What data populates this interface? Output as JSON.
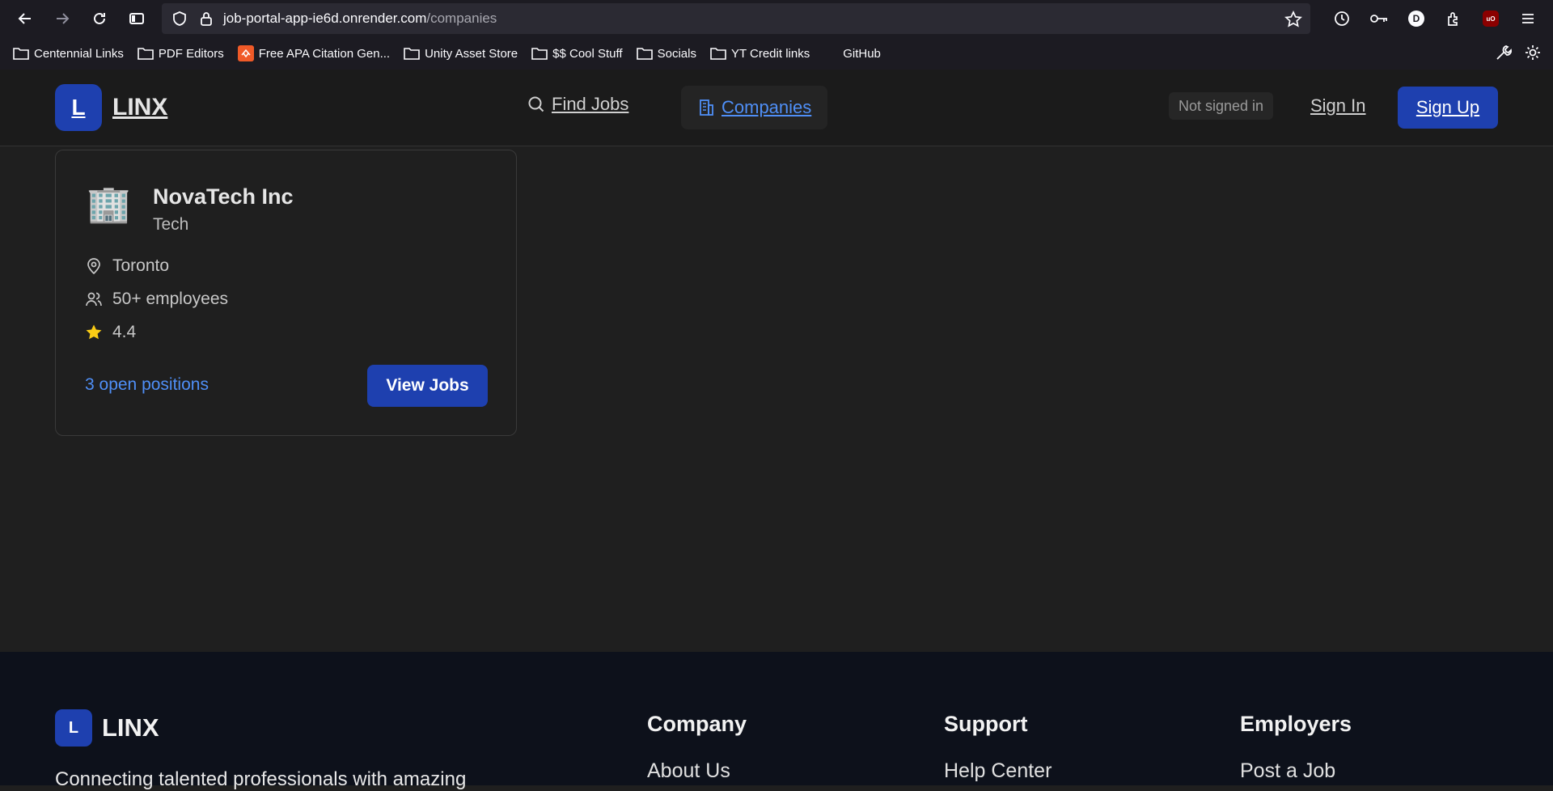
{
  "browser": {
    "url_host": "job-portal-app-ie6d.onrender.com",
    "url_path": "/companies",
    "profile_initial": "D",
    "ublock_label": "uO",
    "bookmarks": [
      {
        "label": "Centennial Links",
        "icon": "folder-icon"
      },
      {
        "label": "PDF Editors",
        "icon": "folder-icon"
      },
      {
        "label": "Free APA Citation Gen...",
        "icon": "apa-site-icon"
      },
      {
        "label": "Unity Asset Store",
        "icon": "folder-icon"
      },
      {
        "label": "$$ Cool Stuff",
        "icon": "folder-icon"
      },
      {
        "label": "Socials",
        "icon": "folder-icon"
      },
      {
        "label": "YT Credit links",
        "icon": "folder-icon"
      },
      {
        "label": "GitHub",
        "icon": "none"
      }
    ]
  },
  "header": {
    "logo_letter": "L",
    "logo_text": "LINX",
    "nav": {
      "find_jobs": "Find Jobs",
      "companies": "Companies"
    },
    "auth_status": "Not signed in",
    "sign_in": "Sign In",
    "sign_up": "Sign Up"
  },
  "company": {
    "logo_emoji": "🏢",
    "name": "NovaTech Inc",
    "industry": "Tech",
    "location": "Toronto",
    "employees": "50+ employees",
    "rating": "4.4",
    "open_positions": "3 open positions",
    "view_jobs": "View Jobs"
  },
  "footer": {
    "logo_letter": "L",
    "logo_text": "LINX",
    "tagline": "Connecting talented professionals with amazing",
    "columns": [
      {
        "title": "Company",
        "first_link": "About Us"
      },
      {
        "title": "Support",
        "first_link": "Help Center"
      },
      {
        "title": "Employers",
        "first_link": "Post a Job"
      }
    ]
  },
  "colors": {
    "accent_blue": "#1e40af",
    "link_blue": "#4f8ff7",
    "star_yellow": "#facc15",
    "page_bg": "#1f1f1f",
    "footer_bg": "#0d111b"
  }
}
